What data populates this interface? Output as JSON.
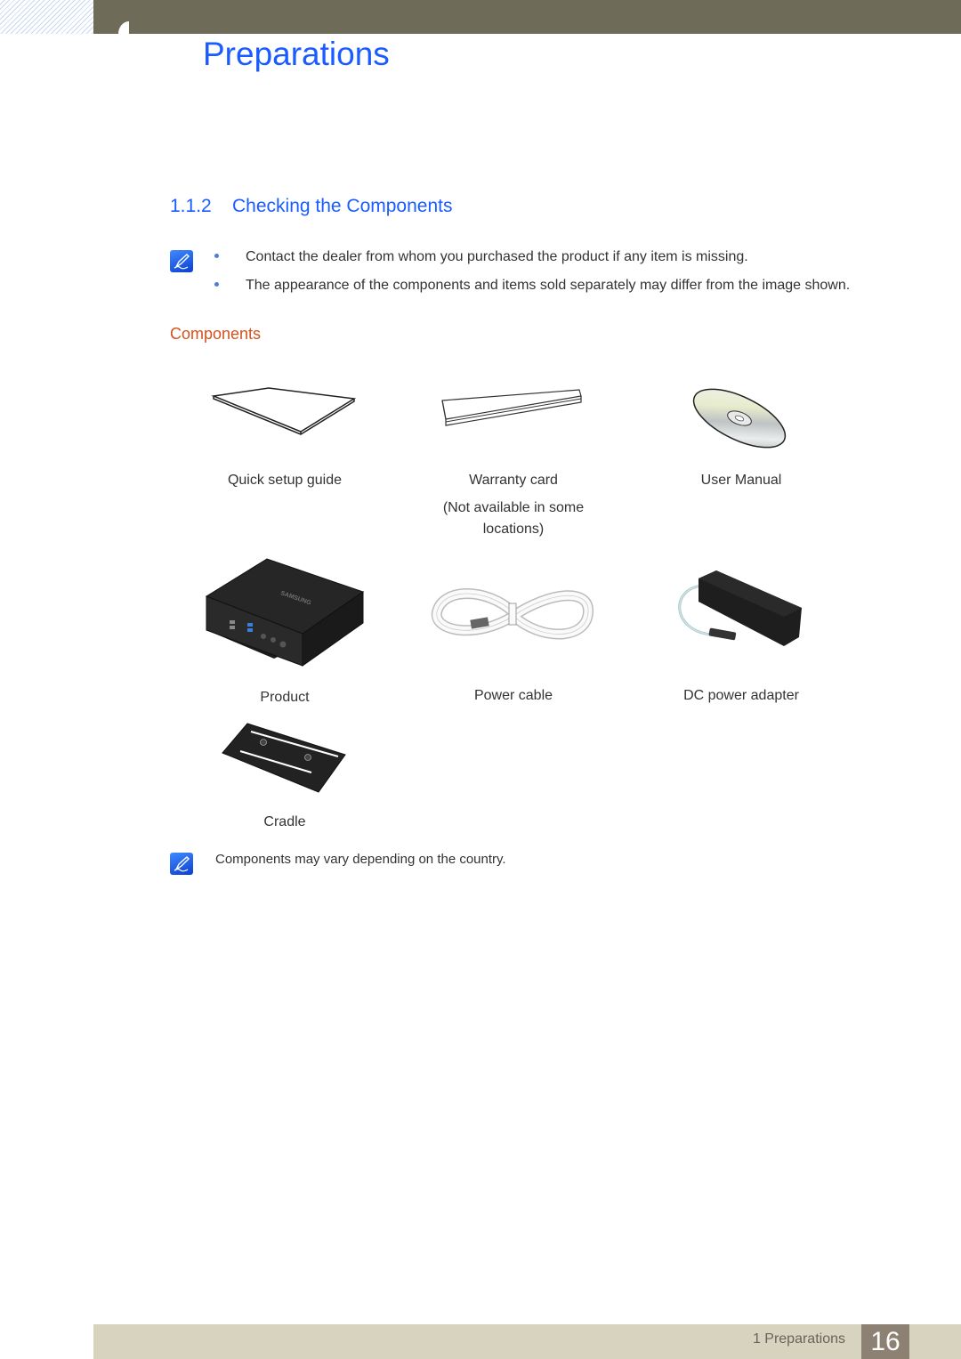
{
  "header": {
    "chapter_title": "Preparations"
  },
  "section": {
    "number": "1.1.2",
    "title": "Checking the Components"
  },
  "notes": {
    "icon": "note-pen-icon",
    "bullets": [
      "Contact the dealer from whom you purchased the product if any item is missing.",
      "The appearance of the components and items sold separately may differ from the image shown."
    ]
  },
  "subsection": {
    "title": "Components"
  },
  "components": [
    {
      "name": "Quick setup guide",
      "icon": "booklet-icon"
    },
    {
      "name": "Warranty card",
      "note_line1": "(Not available in some",
      "note_line2": "locations)",
      "icon": "card-icon"
    },
    {
      "name": "User Manual",
      "icon": "cd-disc-icon"
    },
    {
      "name": "Product",
      "icon": "product-box-icon",
      "brand": "SAMSUNG"
    },
    {
      "name": "Power cable",
      "icon": "power-cable-icon"
    },
    {
      "name": "DC power adapter",
      "icon": "power-adapter-icon"
    },
    {
      "name": "Cradle",
      "icon": "cradle-icon"
    }
  ],
  "bottom_note": "Components may vary depending on the country.",
  "footer": {
    "chapter_label": "1 Preparations",
    "page_number": "16"
  },
  "colors": {
    "accent_blue": "#1a5cff",
    "subheading_orange": "#d2531e",
    "header_bar": "#6e6b59",
    "footer_bar": "#d8d3be",
    "page_badge": "#8c8173"
  }
}
